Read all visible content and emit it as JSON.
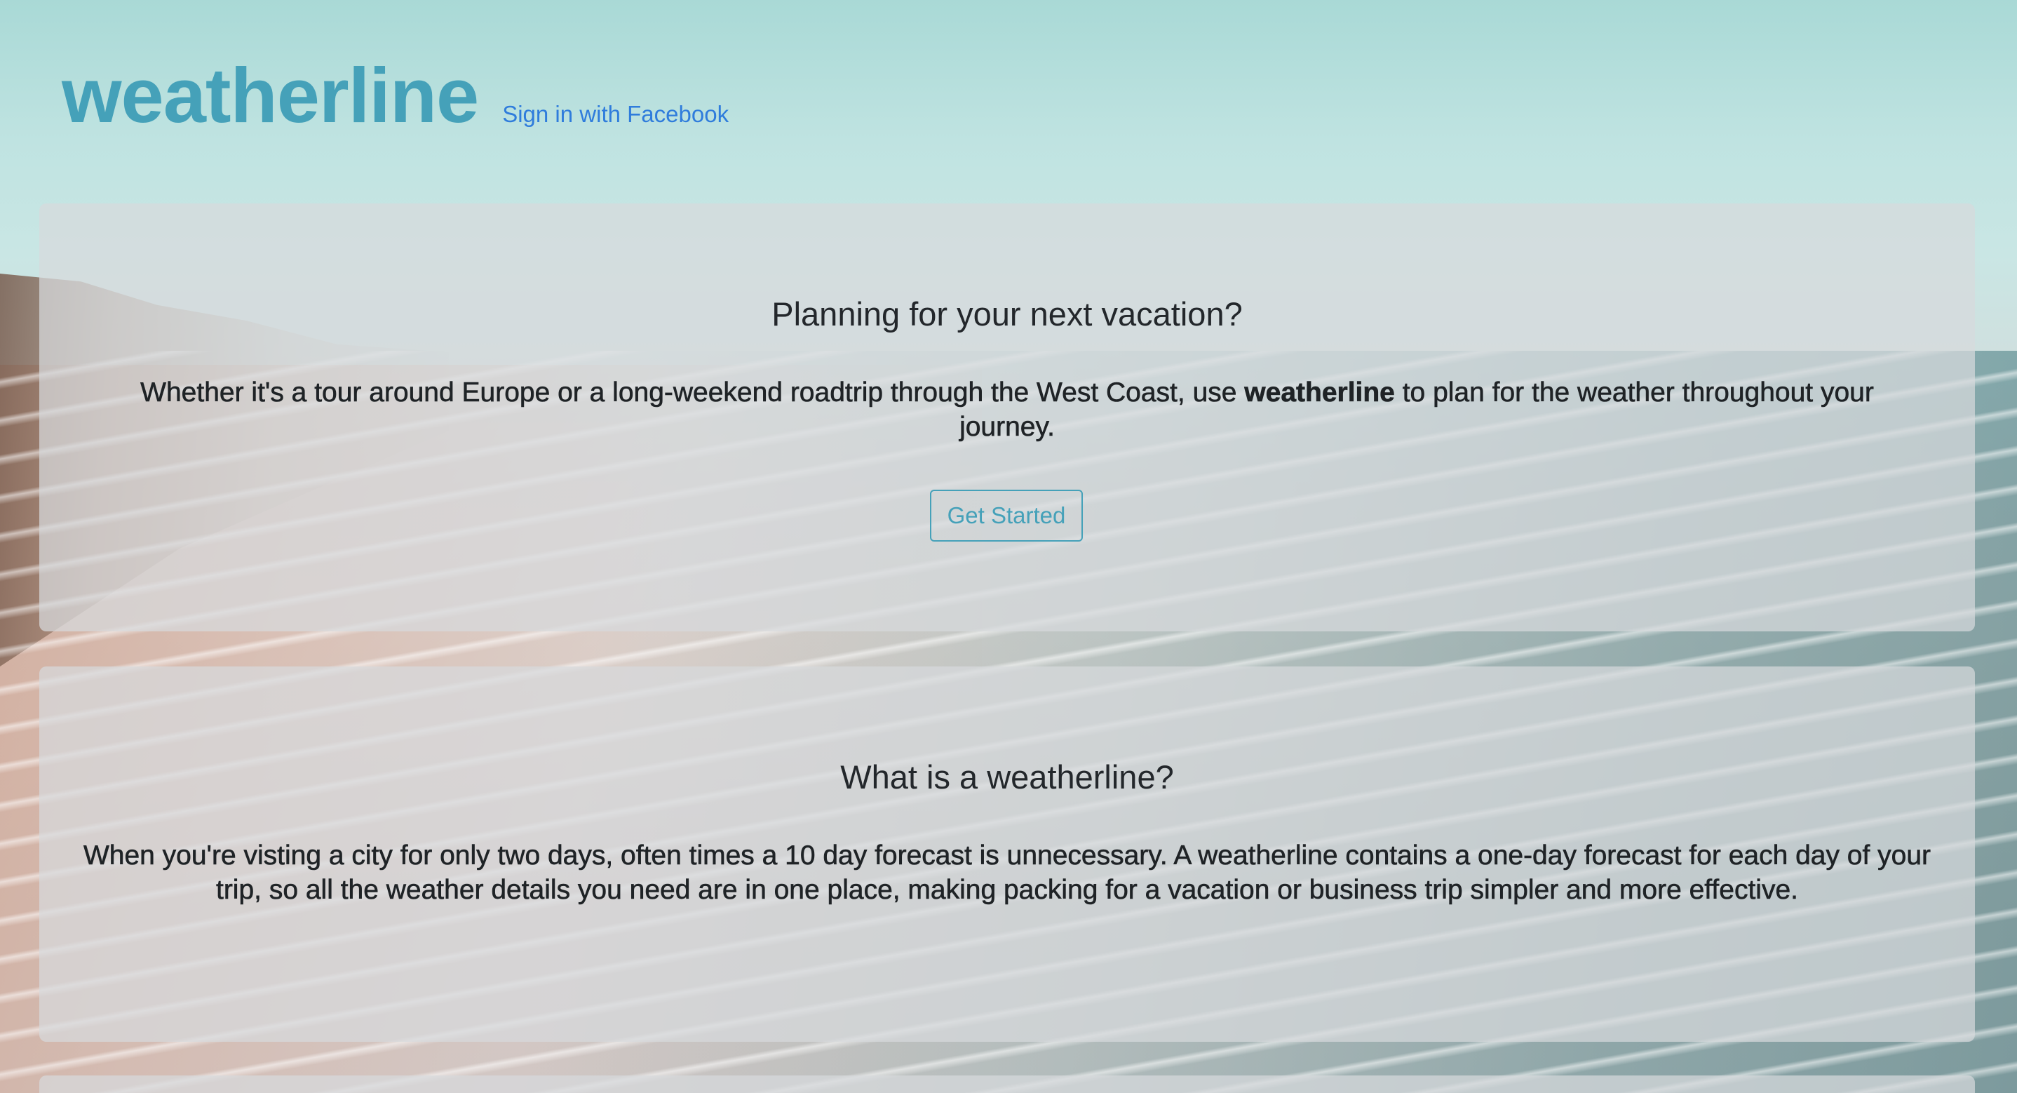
{
  "header": {
    "logo_text": "weatherline",
    "signin_label": "Sign in with Facebook"
  },
  "hero": {
    "title": "Planning for your next vacation?",
    "text_before": "Whether it's a tour around Europe or a long-weekend roadtrip through the West Coast, use ",
    "text_bold": "weatherline",
    "text_after": " to plan for the weather throughout your journey.",
    "cta_label": "Get Started"
  },
  "about": {
    "title": "What is a weatherline?",
    "text": "When you're visting a city for only two days, often times a 10 day forecast is unnecessary. A weatherline contains a one-day forecast for each day of your trip, so all the weather details you need are in one place, making packing for a vacation or business trip simpler and more effective."
  },
  "colors": {
    "brand": "#45a1b9",
    "link": "#2f7cdc",
    "panel": "rgba(215,218,220,0.72)"
  }
}
